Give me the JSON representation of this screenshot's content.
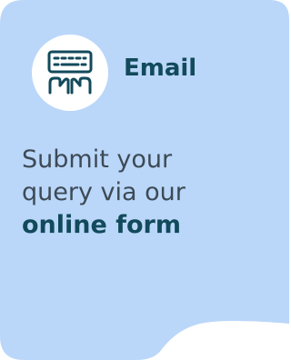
{
  "card": {
    "background_color": "#bad7fa",
    "accent_color": "#124a5b",
    "icon": "keyboard-typing-icon",
    "title": "Email",
    "body_line_1": "Submit your",
    "body_line_2": "query via our",
    "body_emphasis": "online form"
  }
}
